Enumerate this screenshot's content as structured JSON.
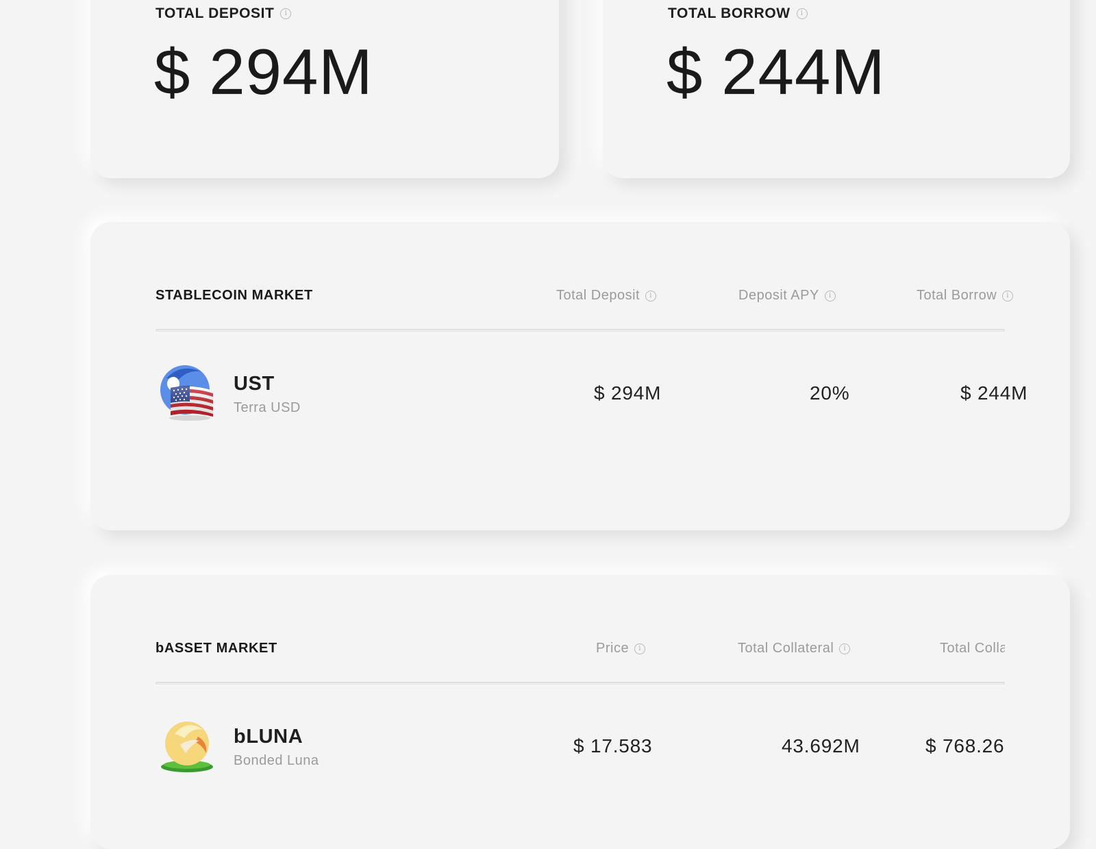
{
  "summary": {
    "total_deposit": {
      "label": "TOTAL DEPOSIT",
      "value": "$ 294M"
    },
    "total_borrow": {
      "label": "TOTAL BORROW",
      "value": "$ 244M"
    }
  },
  "stablecoin_market": {
    "title": "STABLECOIN MARKET",
    "columns": [
      "Total Deposit",
      "Deposit APY",
      "Total Borrow"
    ],
    "rows": [
      {
        "symbol": "UST",
        "name": "Terra USD",
        "icon": "ust-icon",
        "total_deposit": "$ 294M",
        "deposit_apy": "20%",
        "total_borrow": "$ 244M"
      }
    ]
  },
  "basset_market": {
    "title": "bASSET MARKET",
    "columns": [
      "Price",
      "Total Collateral",
      "Total Collateral Value"
    ],
    "rows": [
      {
        "symbol": "bLUNA",
        "name": "Bonded Luna",
        "icon": "bluna-icon",
        "price": "$ 17.583",
        "total_collateral": "43.692M",
        "total_collateral_value": "$ 768.26"
      }
    ]
  },
  "info_icon_glyph": "i",
  "colors": {
    "background": "#f4f4f4",
    "text": "#1f1f1f",
    "muted": "#9b9b9b"
  }
}
